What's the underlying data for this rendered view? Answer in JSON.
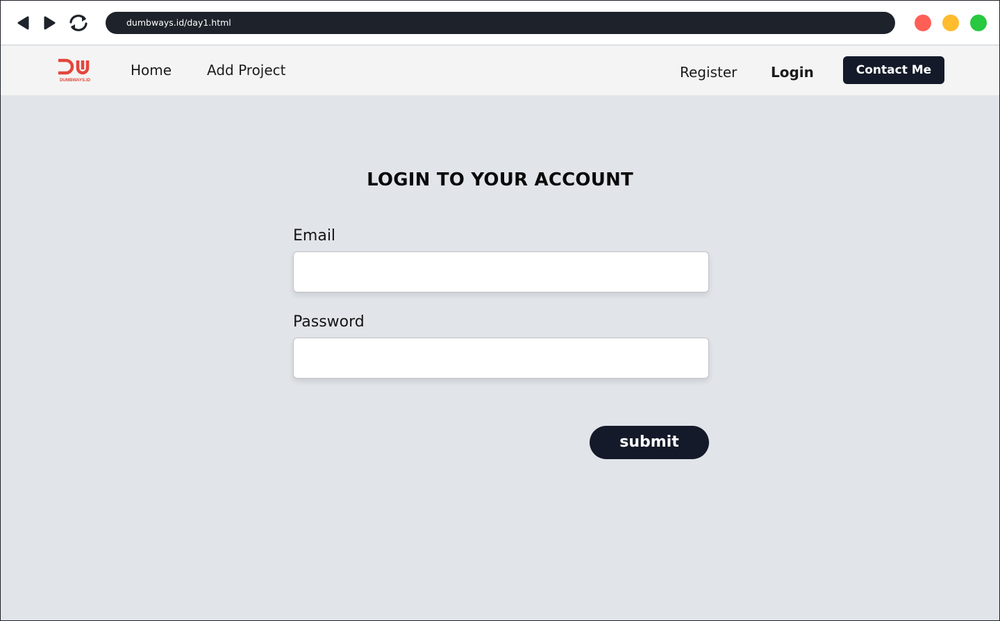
{
  "browser": {
    "url": "dumbways.id/day1.html",
    "controls": {
      "back_icon": "triangle-left",
      "forward_icon": "triangle-right",
      "reload_icon": "refresh-arrows"
    },
    "window_dots": [
      "#ff5f57",
      "#febc2e",
      "#28c840"
    ]
  },
  "navbar": {
    "logo": {
      "mark": "DW",
      "text": "DUMBWAYS.ID",
      "color": "#e3463c"
    },
    "links": {
      "home": "Home",
      "add_project": "Add Project",
      "register": "Register",
      "login": "Login"
    },
    "contact_button": "Contact Me"
  },
  "form": {
    "title": "LOGIN TO YOUR ACCOUNT",
    "email_label": "Email",
    "email_value": "",
    "password_label": "Password",
    "password_value": "",
    "submit_label": "submit"
  },
  "colors": {
    "page_bg": "#e1e4e9",
    "navbar_bg": "#f4f4f4",
    "dark": "#141a29",
    "url_bar": "#1e232b"
  }
}
